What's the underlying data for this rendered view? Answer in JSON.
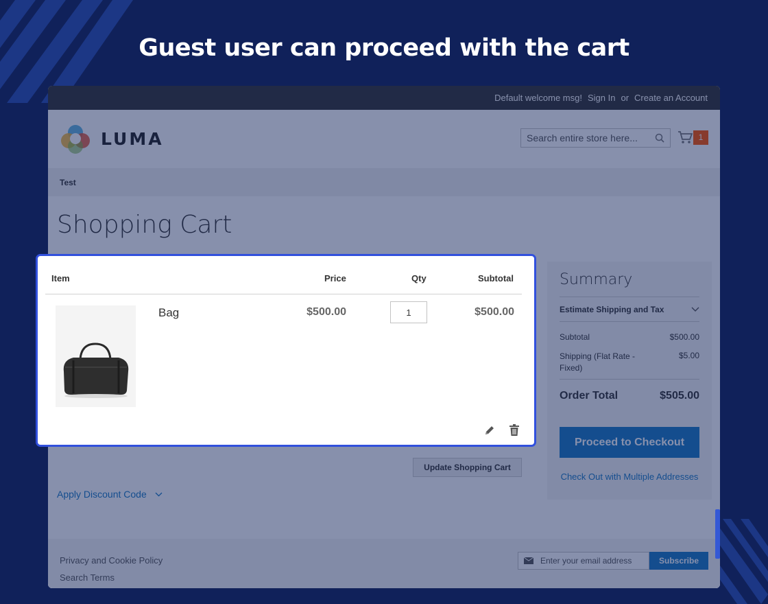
{
  "headline": "Guest user can proceed with the cart",
  "topbar": {
    "welcome": "Default welcome msg!",
    "sign_in": "Sign In",
    "or": "or",
    "create_account": "Create an Account"
  },
  "header": {
    "logo_text": "LUMA",
    "search_placeholder": "Search entire store here...",
    "cart_count": "1"
  },
  "nav": {
    "item": "Test"
  },
  "page_title": "Shopping Cart",
  "cart": {
    "columns": {
      "item": "Item",
      "price": "Price",
      "qty": "Qty",
      "subtotal": "Subtotal"
    },
    "items": [
      {
        "name": "Bag",
        "price": "$500.00",
        "qty": "1",
        "subtotal": "$500.00"
      }
    ]
  },
  "update_cart_label": "Update Shopping Cart",
  "discount_label": "Apply Discount Code",
  "summary": {
    "title": "Summary",
    "estimate_label": "Estimate Shipping and Tax",
    "subtotal_label": "Subtotal",
    "subtotal_value": "$500.00",
    "shipping_label": "Shipping (Flat Rate - Fixed)",
    "shipping_value": "$5.00",
    "order_total_label": "Order Total",
    "order_total_value": "$505.00",
    "checkout_label": "Proceed to Checkout",
    "multi_address_label": "Check Out with Multiple Addresses"
  },
  "footer": {
    "links": [
      "Privacy and Cookie Policy",
      "Search Terms"
    ],
    "newsletter_placeholder": "Enter your email address",
    "subscribe_label": "Subscribe"
  },
  "colors": {
    "background": "#10215a",
    "highlight_border": "#3150dd",
    "luma_blue": "#1979c3",
    "cart_badge": "#ff5501"
  }
}
